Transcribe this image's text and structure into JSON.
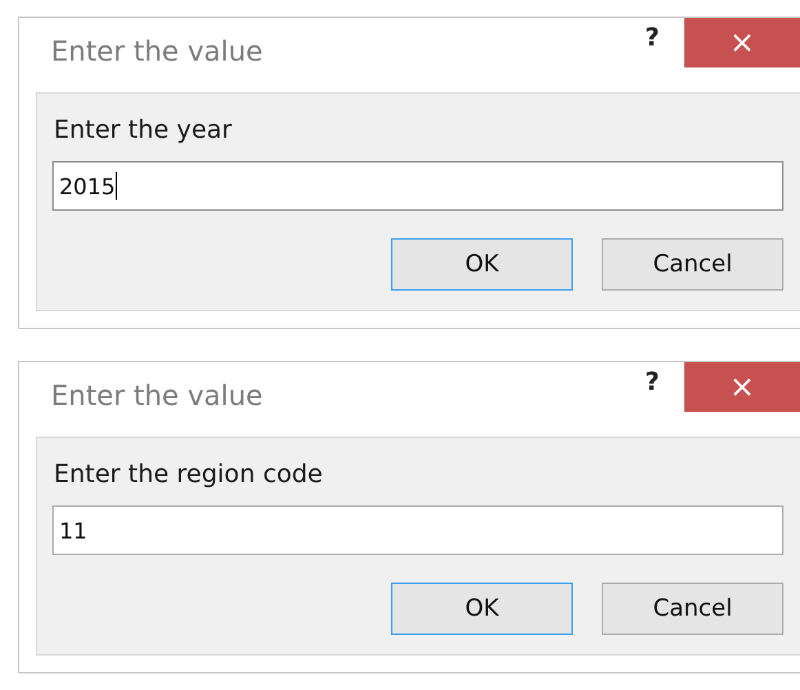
{
  "dialogs": [
    {
      "title": "Enter the value",
      "help": "?",
      "close": "×",
      "prompt": "Enter the year",
      "input": {
        "value": "2015",
        "focused": true
      },
      "buttons": [
        {
          "label": "OK",
          "default": true
        },
        {
          "label": "Cancel",
          "default": false
        }
      ]
    },
    {
      "title": "Enter the value",
      "help": "?",
      "close": "×",
      "prompt": "Enter the region code",
      "input": {
        "value": "11",
        "focused": false
      },
      "buttons": [
        {
          "label": "OK",
          "default": true
        },
        {
          "label": "Cancel",
          "default": false
        }
      ]
    }
  ]
}
